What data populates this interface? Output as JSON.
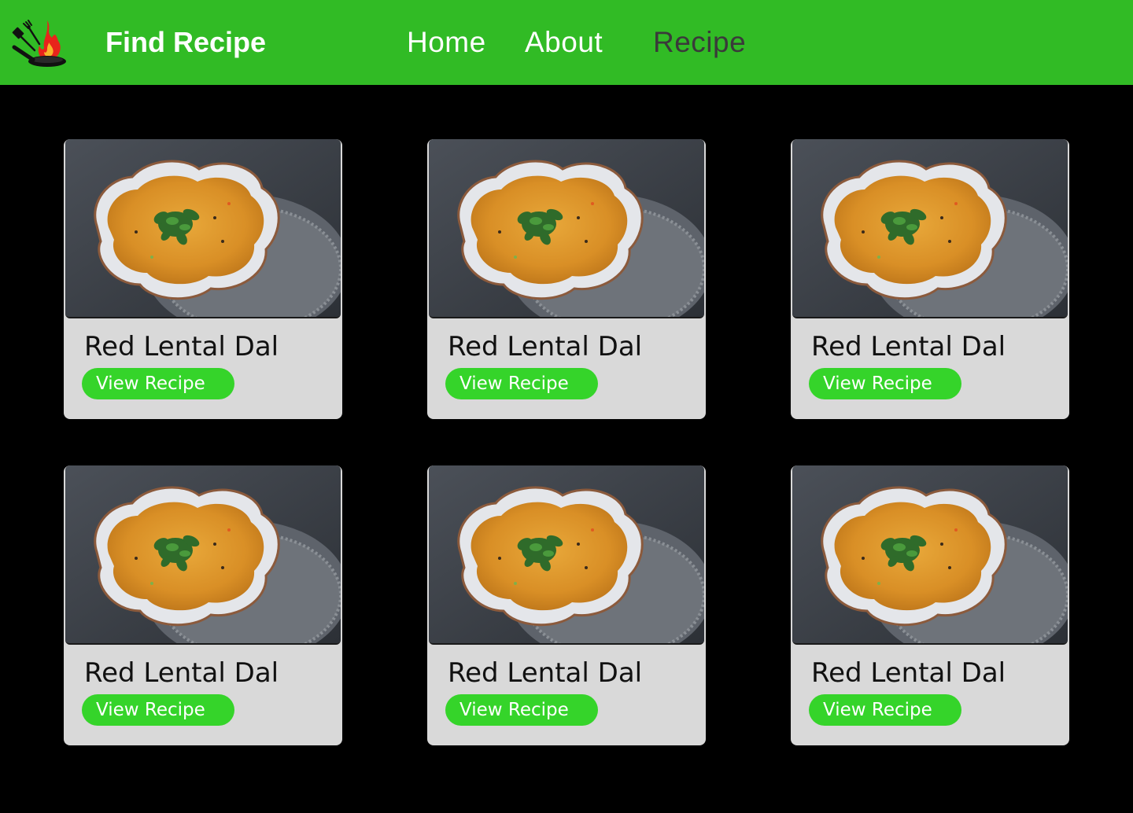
{
  "header": {
    "brand": "Find Recipe",
    "logo_icon": "flaming-pan-logo-icon",
    "nav": [
      {
        "label": "Home",
        "active": false
      },
      {
        "label": "About",
        "active": false
      },
      {
        "label": "Recipe",
        "active": true
      }
    ]
  },
  "colors": {
    "header_bg": "#31bb25",
    "page_bg": "#000000",
    "card_bg": "#d9d9d9",
    "button_bg": "#35d42a",
    "active_nav": "#3a3a3a"
  },
  "recipes": [
    {
      "title": "Red Lental Dal",
      "button_label": "View Recipe",
      "image": "red-lentil-dal-bowl-image"
    },
    {
      "title": "Red Lental Dal",
      "button_label": "View Recipe",
      "image": "red-lentil-dal-bowl-image"
    },
    {
      "title": "Red Lental Dal",
      "button_label": "View Recipe",
      "image": "red-lentil-dal-bowl-image"
    },
    {
      "title": "Red Lental Dal",
      "button_label": "View Recipe",
      "image": "red-lentil-dal-bowl-image"
    },
    {
      "title": "Red Lental Dal",
      "button_label": "View Recipe",
      "image": "red-lentil-dal-bowl-image"
    },
    {
      "title": "Red Lental Dal",
      "button_label": "View Recipe",
      "image": "red-lentil-dal-bowl-image"
    }
  ]
}
